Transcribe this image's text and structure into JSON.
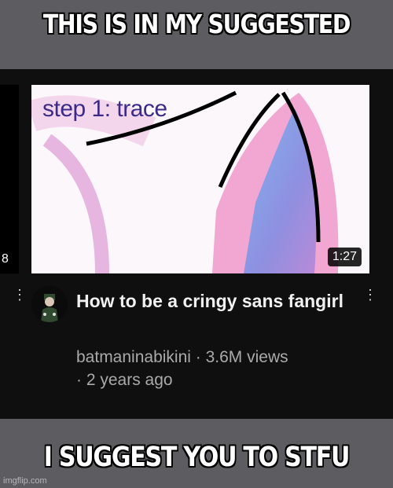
{
  "meme": {
    "top_caption": "THIS IS IN MY SUGGESTED",
    "bottom_caption": "I SUGGEST YOU TO STFU",
    "watermark": "imgflip.com"
  },
  "video": {
    "thumbnail_text": "step 1: trace",
    "duration": "1:27",
    "left_partial_number": "8",
    "title": "How to be a cringy sans fangirl",
    "channel_line": "batmaninabikini · 3.6M views",
    "age_line": "· 2 years ago",
    "menu_icon": "kebab-menu-icon",
    "colors": {
      "background": "#0f0f0f",
      "ear_pink": "#f2a6d2",
      "ear_blue": "#5fa0e8",
      "text_purple": "#3b2a8a"
    }
  }
}
